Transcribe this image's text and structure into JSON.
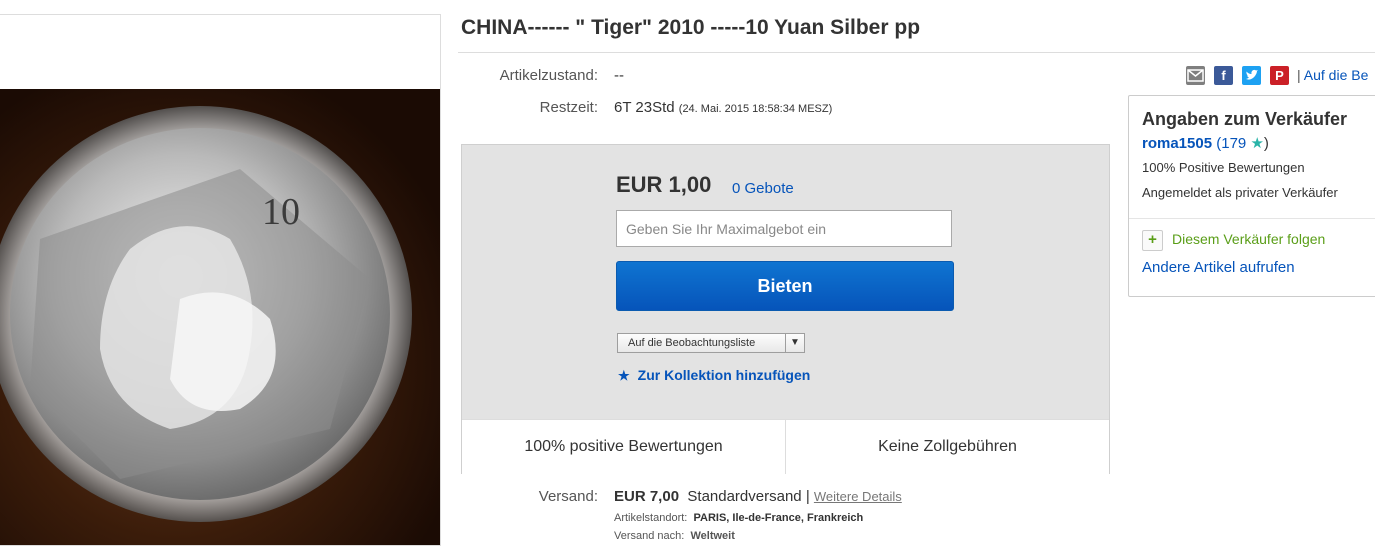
{
  "item": {
    "title": "CHINA------ \" Tiger\" 2010 -----10 Yuan Silber pp",
    "condition_label": "Artikelzustand:",
    "condition_value": "--",
    "time_label": "Restzeit:",
    "time_value": "6T 23Std",
    "time_end": "(24. Mai. 2015   18:58:34 MESZ)"
  },
  "share": {
    "icons": [
      "email-icon",
      "facebook-icon",
      "twitter-icon",
      "pinterest-icon"
    ],
    "separator": "|",
    "link": "Auf die Be"
  },
  "bid": {
    "price": "EUR 1,00",
    "bids": "0 Gebote",
    "input_placeholder": "Geben Sie Ihr Maximalgebot ein",
    "button": "Bieten",
    "watch": "Auf die Beobachtungsliste",
    "collection": "Zur Kollektion hinzufügen",
    "footer_left": "100% positive Bewertungen",
    "footer_right": "Keine Zollgebühren"
  },
  "seller": {
    "title": "Angaben zum Verkäufer",
    "name": "roma1505",
    "score_open": "(",
    "score": "179",
    "score_close": ")",
    "positive": "100% Positive Bewertungen",
    "type": "Angemeldet als privater Verkäufer",
    "follow": "Diesem Verkäufer folgen",
    "other_items": "Andere Artikel aufrufen"
  },
  "shipping": {
    "label": "Versand:",
    "price": "EUR 7,00",
    "method": "Standardversand",
    "separator": "|",
    "details": "Weitere Details",
    "location_label": "Artikelstandort:",
    "location": "PARIS, Ile-de-France, Frankreich",
    "ships_to_label": "Versand nach:",
    "ships_to": "Weltweit"
  },
  "colors": {
    "link": "#0654ba",
    "button": "#0654ba",
    "follow_green": "#5a9e18"
  }
}
